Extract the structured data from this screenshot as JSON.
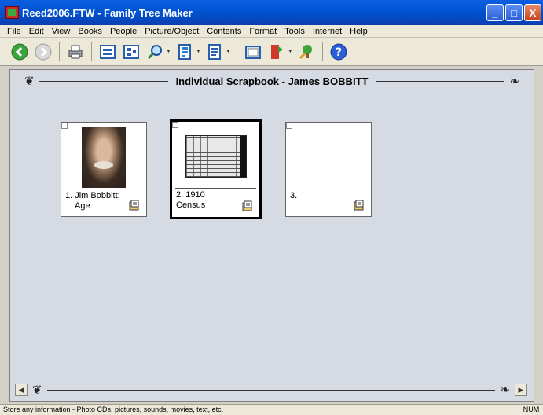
{
  "window": {
    "title": "Reed2006.FTW - Family Tree Maker",
    "minimize": "_",
    "maximize": "□",
    "close": "X"
  },
  "menu": [
    "File",
    "Edit",
    "View",
    "Books",
    "People",
    "Picture/Object",
    "Contents",
    "Format",
    "Tools",
    "Internet",
    "Help"
  ],
  "toolbar": {
    "icons": [
      "back-icon",
      "forward-icon",
      "print-icon",
      "family-page-icon",
      "pedigree-icon",
      "search-icon",
      "descendant-icon",
      "report-icon",
      "scrapbook-icon",
      "bookmark-icon",
      "tree-icon",
      "help-icon"
    ]
  },
  "scrapbook": {
    "title": "Individual Scrapbook - James BOBBITT",
    "items": [
      {
        "caption_line1": "1. Jim Bobbitt:",
        "caption_line2": "Age"
      },
      {
        "caption_line1": "2. 1910 Census",
        "caption_line2": ""
      },
      {
        "caption_line1": "3.",
        "caption_line2": ""
      }
    ]
  },
  "status": {
    "text": "Store any information - Photo CDs, pictures, sounds, movies, text, etc.",
    "num": "NUM"
  },
  "colors": {
    "titlebar": "#0052d0",
    "content_bg": "#d6dbe3",
    "chrome": "#ece9d8"
  }
}
